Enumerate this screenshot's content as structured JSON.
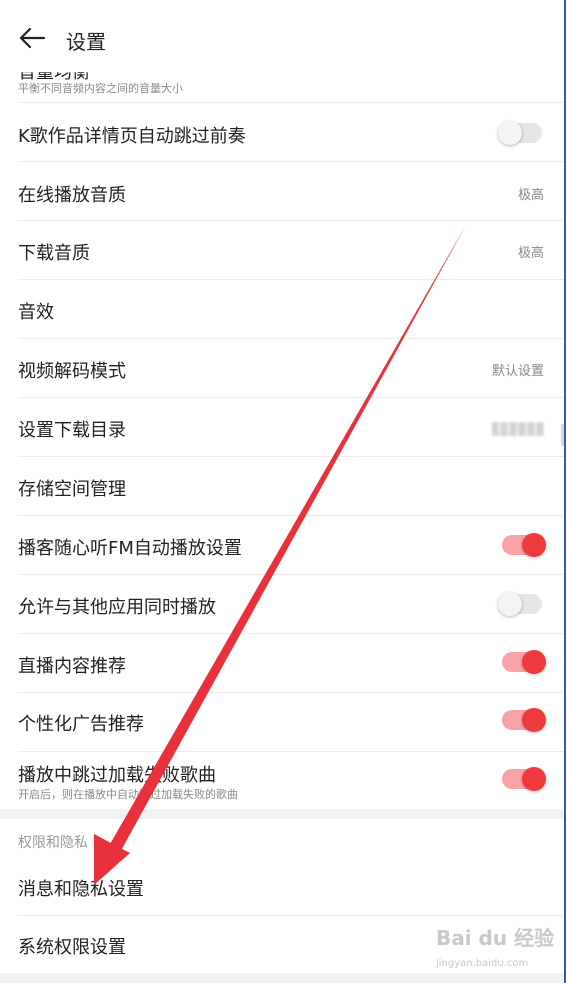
{
  "header": {
    "title": "设置"
  },
  "items": {
    "volume_balance": {
      "label": "音量均衡",
      "sub": "平衡不同音频内容之间的音量大小"
    },
    "k_song": {
      "label": "K歌作品详情页自动跳过前奏",
      "toggle": "off"
    },
    "online_quality": {
      "label": "在线播放音质",
      "value": "极高"
    },
    "download_quality": {
      "label": "下载音质",
      "value": "极高"
    },
    "sound_effect": {
      "label": "音效"
    },
    "video_decode": {
      "label": "视频解码模式",
      "value": "默认设置"
    },
    "download_dir": {
      "label": "设置下载目录"
    },
    "storage": {
      "label": "存储空间管理"
    },
    "podcast_fm": {
      "label": "播客随心听FM自动播放设置",
      "toggle": "on"
    },
    "allow_other_apps": {
      "label": "允许与其他应用同时播放",
      "toggle": "off"
    },
    "live_recommend": {
      "label": "直播内容推荐",
      "toggle": "on"
    },
    "ad_recommend": {
      "label": "个性化广告推荐",
      "toggle": "on"
    },
    "skip_failed": {
      "label": "播放中跳过加载失败歌曲",
      "sub": "开启后，则在播放中自动跳过加载失败的歌曲",
      "toggle": "on"
    }
  },
  "privacy_section": {
    "title": "权限和隐私",
    "items": [
      "消息和隐私设置",
      "系统权限设置"
    ]
  },
  "colors": {
    "accent": "#ef3a3e",
    "arrow": "#e8313a"
  },
  "watermark": {
    "text": "Bai du 经验",
    "sub": "jingyan.baidu.com"
  }
}
